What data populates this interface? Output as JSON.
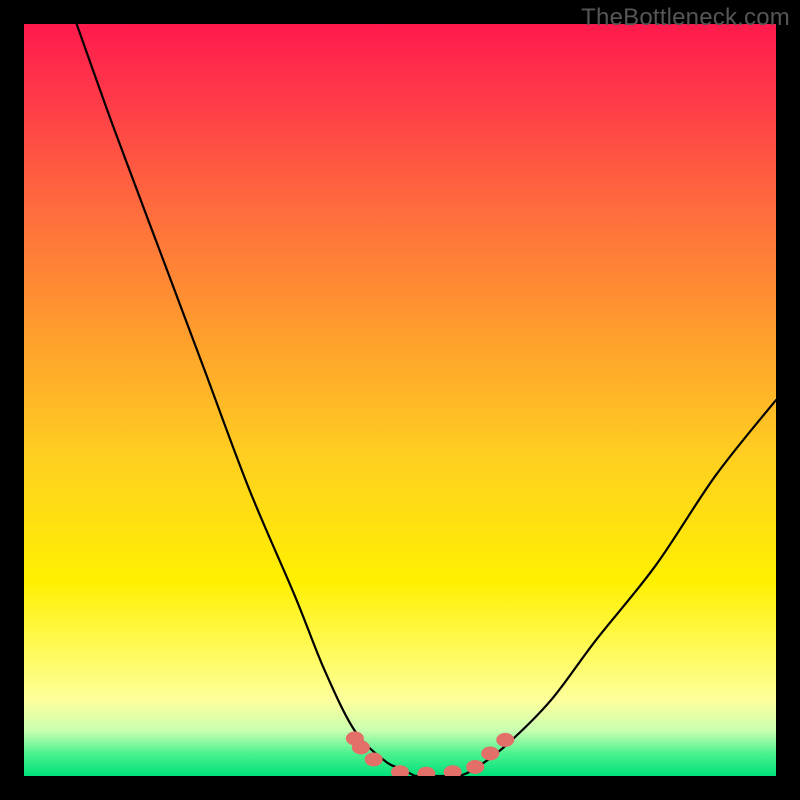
{
  "watermark": "TheBottleneck.com",
  "chart_data": {
    "type": "line",
    "title": "",
    "xlabel": "",
    "ylabel": "",
    "xlim": [
      0,
      100
    ],
    "ylim": [
      0,
      100
    ],
    "series": [
      {
        "name": "left-curve",
        "x": [
          7,
          12,
          18,
          24,
          30,
          36,
          40,
          44,
          48,
          50,
          52
        ],
        "values": [
          100,
          86,
          70,
          54,
          38,
          24,
          14,
          6,
          2,
          1,
          0
        ]
      },
      {
        "name": "right-curve",
        "x": [
          58,
          60,
          64,
          70,
          76,
          84,
          92,
          100
        ],
        "values": [
          0,
          1,
          4,
          10,
          18,
          28,
          40,
          50
        ]
      },
      {
        "name": "flat-bottom",
        "x": [
          52,
          58
        ],
        "values": [
          0,
          0
        ]
      }
    ],
    "markers": [
      {
        "name": "bead",
        "x": 44.0,
        "y": 5.0
      },
      {
        "name": "bead",
        "x": 44.8,
        "y": 3.8
      },
      {
        "name": "bead",
        "x": 46.5,
        "y": 2.2
      },
      {
        "name": "bead",
        "x": 50.0,
        "y": 0.5
      },
      {
        "name": "bead",
        "x": 53.5,
        "y": 0.3
      },
      {
        "name": "bead",
        "x": 57.0,
        "y": 0.5
      },
      {
        "name": "bead",
        "x": 60.0,
        "y": 1.2
      },
      {
        "name": "bead",
        "x": 62.0,
        "y": 3.0
      },
      {
        "name": "bead",
        "x": 64.0,
        "y": 4.8
      }
    ],
    "colors": {
      "curve": "#000000",
      "bead": "#e27068"
    }
  }
}
